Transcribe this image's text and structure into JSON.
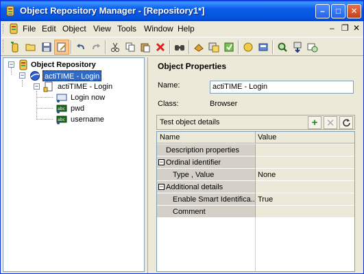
{
  "titlebar": {
    "title": "Object Repository Manager - [Repository1*]",
    "minimize": "–",
    "maximize": "□",
    "close": "✕"
  },
  "menubar": {
    "items": [
      "File",
      "Edit",
      "Object",
      "View",
      "Tools",
      "Window",
      "Help"
    ],
    "mdi_minimize": "–",
    "mdi_restore": "❐",
    "mdi_close": "✕"
  },
  "toolbar": {
    "icons": [
      "add-object-icon",
      "open-icon",
      "save-icon",
      "edit-active-icon",
      "undo-icon",
      "redo-icon",
      "cut-icon",
      "copy-icon",
      "paste-icon",
      "delete-icon",
      "find-icon",
      "object-spy-icon",
      "add-objects-icon",
      "update-icon",
      "highlight-icon",
      "locate-icon",
      "search-icon",
      "export-icon",
      "define-icon"
    ]
  },
  "tree": {
    "root": "Object Repository",
    "browser": "actiTIME - Login",
    "page": "actiTIME - Login",
    "children": [
      "Login now",
      "pwd",
      "username"
    ]
  },
  "properties": {
    "title": "Object Properties",
    "name_label": "Name:",
    "name_value": "actiTIME - Login",
    "class_label": "Class:",
    "class_value": "Browser",
    "details_title": "Test object details",
    "grid": {
      "col_name": "Name",
      "col_value": "Value",
      "rows": [
        {
          "name": "Description properties",
          "value": "",
          "indent": 1,
          "expander": ""
        },
        {
          "name": "Ordinal identifier",
          "value": "",
          "indent": 1,
          "expander": "−"
        },
        {
          "name": "Type , Value",
          "value": "None",
          "indent": 2,
          "expander": ""
        },
        {
          "name": "Additional details",
          "value": "",
          "indent": 1,
          "expander": "−"
        },
        {
          "name": "Enable Smart Identifica...",
          "value": "True",
          "indent": 2,
          "expander": ""
        },
        {
          "name": "Comment",
          "value": "",
          "indent": 2,
          "expander": ""
        }
      ]
    }
  }
}
